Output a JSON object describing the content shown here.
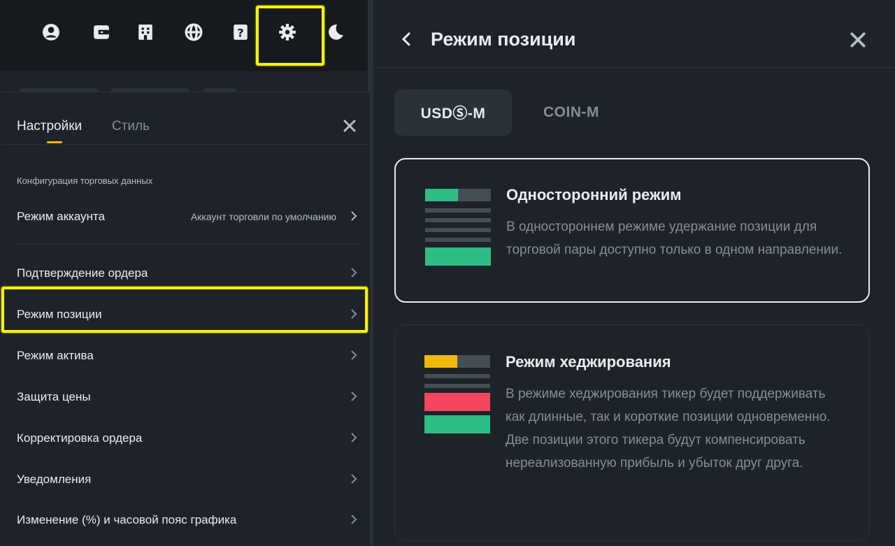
{
  "topbar": {
    "icons": [
      "user-circle-icon",
      "wallet-icon",
      "building-icon",
      "globe-icon",
      "help-icon",
      "gear-icon",
      "moon-icon"
    ],
    "highlight": "#f5f10a"
  },
  "settings": {
    "tabs": [
      "Настройки",
      "Стиль"
    ],
    "section_title": "Конфигурация торговых данных",
    "account_mode": {
      "label": "Режим аккаунта",
      "value": "Аккаунт торговли по умолчанию"
    },
    "items": [
      "Подтверждение ордера",
      "Режим позиции",
      "Режим актива",
      "Защита цены",
      "Корректировка ордера",
      "Уведомления",
      "Изменение (%) и часовой пояс графика"
    ],
    "highlighted_item": "Режим позиции"
  },
  "position_panel": {
    "title": "Режим позиции",
    "segments": [
      "USDⓈ-M",
      "COIN-M"
    ],
    "selected_segment": "USDⓈ-M",
    "modes": [
      {
        "title": "Односторонний режим",
        "description": "В одностороннем режиме удержание позиции для торговой пары доступно только в одном направлении.",
        "selected": true
      },
      {
        "title": "Режим хеджирования",
        "description": "В режиме хеджирования тикер будет поддерживать как длинные, так и короткие позиции одновременно. Две позиции этого тикера будут компенсировать нереализованную прибыль и убыток друг друга.",
        "selected": false
      }
    ]
  },
  "colors": {
    "background": "#1e2329",
    "surface": "#2b3139",
    "accent": "#f0b90b",
    "green": "#2ebd85",
    "red": "#f6465d",
    "text": "#eaecef",
    "muted": "#848e9c"
  }
}
